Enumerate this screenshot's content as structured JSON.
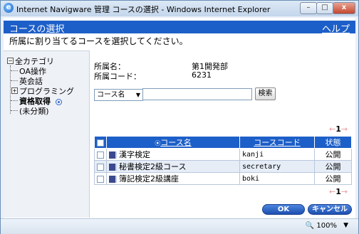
{
  "window": {
    "title": "Internet Navigware 管理 コースの選択 - Windows Internet Explorer",
    "app_icon": "e",
    "controls": {
      "minimize": "–",
      "maximize": "□",
      "close": "x"
    }
  },
  "header": {
    "title": "コースの選択",
    "help": "ヘルプ"
  },
  "subtitle": "所属に割り当てるコースを選択してください。",
  "sidebar": {
    "root": "全カテゴリ",
    "items": [
      {
        "label": "OA操作"
      },
      {
        "label": "英会話"
      },
      {
        "label": "プログラミング"
      },
      {
        "label": "資格取得"
      },
      {
        "label": "(未分類)"
      }
    ]
  },
  "info": {
    "dept_label": "所属名：",
    "dept_value": "第1開発部",
    "code_label": "所属コード：",
    "code_value": "6231"
  },
  "search": {
    "field_selected": "コース名",
    "input_value": "",
    "button": "検索"
  },
  "pager": {
    "page": "1"
  },
  "table": {
    "headers": {
      "name": "コース名",
      "code": "コースコード",
      "status": "状態"
    },
    "rows": [
      {
        "name": "漢字検定",
        "code": "kanji",
        "status": "公開"
      },
      {
        "name": "秘書検定2級コース",
        "code": "secretary",
        "status": "公開"
      },
      {
        "name": "簿記検定2級講座",
        "code": "boki",
        "status": "公開"
      }
    ]
  },
  "buttons": {
    "ok": "OK",
    "cancel": "キャンセル"
  },
  "statusbar": {
    "zoom": "100%"
  },
  "colors": {
    "accent": "#1d5fc8",
    "row_alt": "#e6edf7"
  }
}
